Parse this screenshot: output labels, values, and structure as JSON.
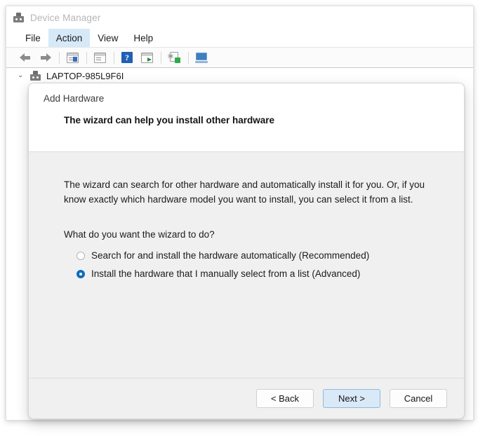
{
  "window": {
    "title": "Device Manager",
    "icon": "device-manager-icon",
    "menu": [
      {
        "label": "File",
        "active": false
      },
      {
        "label": "Action",
        "active": true
      },
      {
        "label": "View",
        "active": false
      },
      {
        "label": "Help",
        "active": false
      }
    ],
    "toolbar": [
      {
        "name": "back-icon",
        "tip": "Back"
      },
      {
        "name": "forward-icon",
        "tip": "Forward"
      },
      {
        "name": "show-hide-console-tree-icon",
        "tip": "Show/hide console tree"
      },
      {
        "name": "properties-icon",
        "tip": "Properties"
      },
      {
        "name": "help-icon",
        "tip": "Help"
      },
      {
        "name": "update-driver-icon",
        "tip": "Update driver"
      },
      {
        "name": "scan-for-hardware-changes-icon",
        "tip": "Scan for hardware changes"
      },
      {
        "name": "display-devices-icon",
        "tip": "Devices by connection"
      }
    ],
    "tree": {
      "chevron": "⌄",
      "root_label": "LAPTOP-985L9F6I"
    }
  },
  "dialog": {
    "caption": "Add Hardware",
    "heading": "The wizard can help you install other hardware",
    "intro": "The wizard can search for other hardware and automatically install it for you. Or, if you know exactly which hardware model you want to install, you can select it from a list.",
    "question": "What do you want the wizard to do?",
    "options": [
      {
        "label": "Search for and install the hardware automatically (Recommended)",
        "checked": false
      },
      {
        "label": "Install the hardware that I manually select from a list (Advanced)",
        "checked": true
      }
    ],
    "buttons": {
      "back": "< Back",
      "next": "Next >",
      "cancel": "Cancel"
    }
  },
  "colors": {
    "accent": "#0f6cbd",
    "menu_highlight": "#d6e9f8",
    "default_button": "#d9e9f7",
    "dialog_bg": "#f0f0f0"
  }
}
